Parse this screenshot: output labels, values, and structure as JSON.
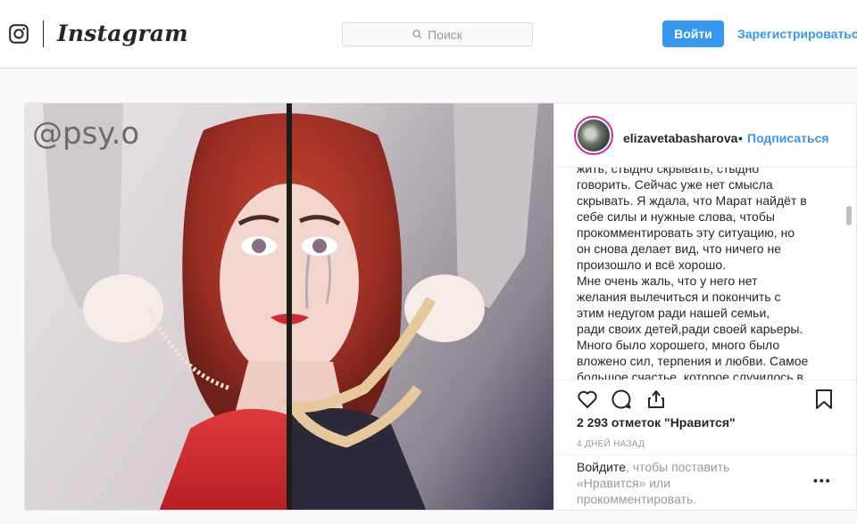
{
  "header": {
    "wordmark": "Instagram",
    "search_placeholder": "Поиск",
    "login_label": "Войти",
    "register_label": "Зарегистрироваться",
    "icons": [
      "instagram-camera-icon",
      "search-icon"
    ]
  },
  "post": {
    "photo_watermark": "@psy.o",
    "author": {
      "username": "elizavetabasharova",
      "separator": "•",
      "follow_label": "Подписаться"
    },
    "caption": "жить, стыдно скрывать, стыдно\nговорить. Сейчас уже нет смысла\nскрывать. Я ждала, что Марат найдёт в\nсебе силы и нужные слова, чтобы\nпрокомментировать эту ситуацию, но\nон снова делает вид, что ничего не\nпроизошло и всё хорошо.\nМне очень жаль, что у него нет\nжелания вылечиться и покончить с\nэтим недугом ради нашей семьи,\nради своих детей,ради своей карьеры.\nМного было хорошего, много было\nвложено сил, терпения и любви. Самое\nбольшое счастье, которое случилось в",
    "likes": "2 293 отметок \"Нравится\"",
    "posted_ago": "4 ДНЕЙ НАЗАД",
    "login_prompt": {
      "link": "Войдите",
      "rest": ", чтобы поставить «Нравится» или прокомментировать."
    },
    "more_label": "•••",
    "action_icons": [
      "heart-icon",
      "comment-icon",
      "share-icon",
      "bookmark-icon"
    ]
  },
  "colors": {
    "accent": "#3897f0",
    "text": "#262626",
    "muted": "#999999",
    "border": "#dbdbdb"
  }
}
